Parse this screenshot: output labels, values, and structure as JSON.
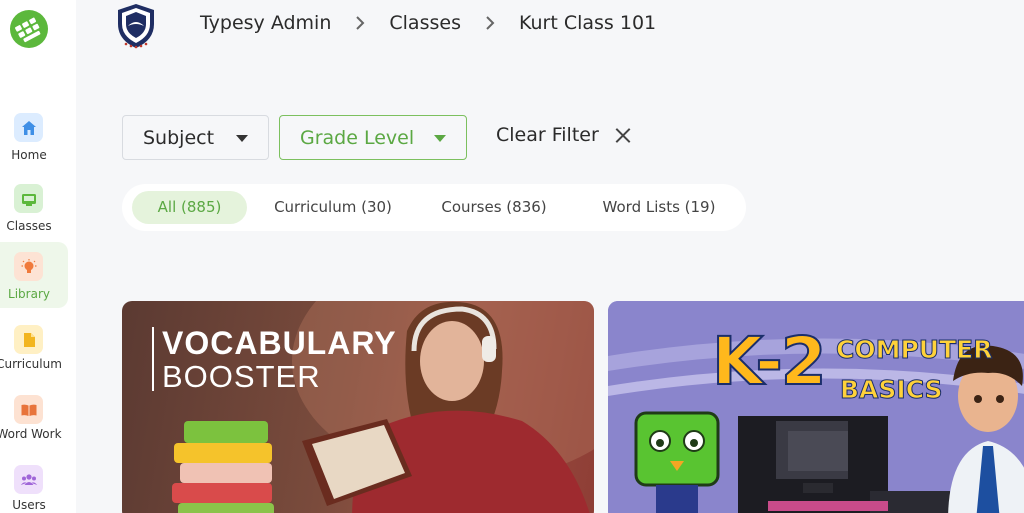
{
  "colors": {
    "accent_green": "#5ba843",
    "active_nav_bg": "#eef7ea",
    "active_tab_bg": "#e5f3dc"
  },
  "app_logo": {
    "icon": "green-grid-logo-icon"
  },
  "brand_logo": {
    "icon": "shield-crest-logo-icon"
  },
  "sidebar": {
    "items": [
      {
        "label": "Home",
        "icon": "home-icon",
        "active": false
      },
      {
        "label": "Classes",
        "icon": "classes-board-icon",
        "active": false
      },
      {
        "label": "Library",
        "icon": "lightbulb-icon",
        "active": true
      },
      {
        "label": "Curriculum",
        "icon": "document-icon",
        "active": false
      },
      {
        "label": "Word Work",
        "icon": "open-book-icon",
        "active": false
      },
      {
        "label": "Users",
        "icon": "users-icon",
        "active": false
      }
    ]
  },
  "breadcrumb": {
    "items": [
      "Typesy Admin",
      "Classes",
      "Kurt Class 101"
    ],
    "separator_icon": "chevron-right-icon"
  },
  "filters": {
    "subject_label": "Subject",
    "grade_level_label": "Grade Level",
    "clear_filter_label": "Clear Filter"
  },
  "tabs": [
    {
      "label": "All (885)",
      "active": true
    },
    {
      "label": "Curriculum (30)",
      "active": false
    },
    {
      "label": "Courses (836)",
      "active": false
    },
    {
      "label": "Word Lists (19)",
      "active": false
    }
  ],
  "cards": [
    {
      "title_line1": "VOCABULARY",
      "title_line2": "BOOSTER"
    },
    {
      "title_big": "K-2",
      "title_small_line1": "COMPUTER",
      "title_small_line2": "BASICS"
    }
  ]
}
